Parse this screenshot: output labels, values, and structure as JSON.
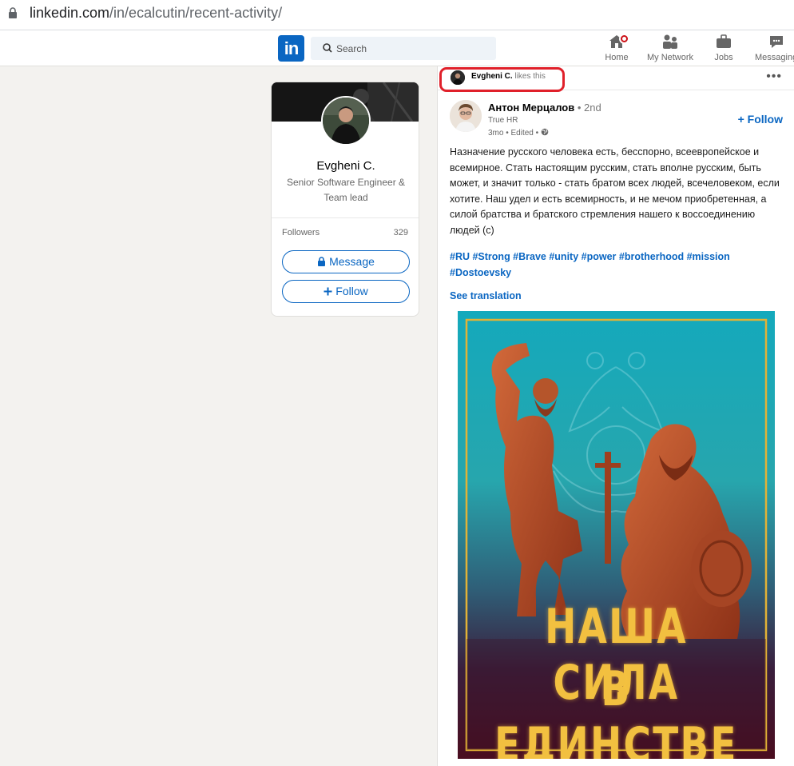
{
  "browser": {
    "url_main": "linkedin.com",
    "url_path": "/in/ecalcutin/recent-activity/"
  },
  "nav": {
    "logo": "in",
    "search_placeholder": "Search",
    "items": [
      {
        "label": "Home",
        "icon": "home-icon"
      },
      {
        "label": "My Network",
        "icon": "network-icon"
      },
      {
        "label": "Jobs",
        "icon": "briefcase-icon"
      },
      {
        "label": "Messaging",
        "icon": "chat-icon"
      }
    ]
  },
  "profile": {
    "name": "Evgheni C.",
    "headline": "Senior Software Engineer & Team lead",
    "followers_label": "Followers",
    "followers_count": "329",
    "message_label": "Message",
    "follow_label": "Follow"
  },
  "activity": {
    "liker_name": "Evgheni C.",
    "liker_action": "likes this"
  },
  "post": {
    "author_name": "Антон Мерцалов",
    "degree": "• 2nd",
    "company": "True HR",
    "meta": "3mo • Edited •",
    "follow_label": "Follow",
    "text": "Назначение русского человека есть, бесспорно, всеевропейское и всемирное. Стать настоящим русским, стать вполне русским, быть может, и значит только - стать братом всех людей, всечеловеком, если хотите. Наш удел и есть всемирность, и не мечом приобретенная, а силой братства и братского стремления нашего к воссоединению людей (с)",
    "hashtags": "#RU #Strong #Brave #unity #power #brotherhood #mission #Dostoevsky",
    "see_translation": "See translation",
    "image_line1": "НАША СИЛА",
    "image_line2": "В ЕДИНСТВЕ"
  },
  "colors": {
    "linkedin_blue": "#0a66c2",
    "highlight_red": "#e0202a",
    "poster_teal": "#1aa7b8",
    "poster_gold": "#f2c040"
  }
}
